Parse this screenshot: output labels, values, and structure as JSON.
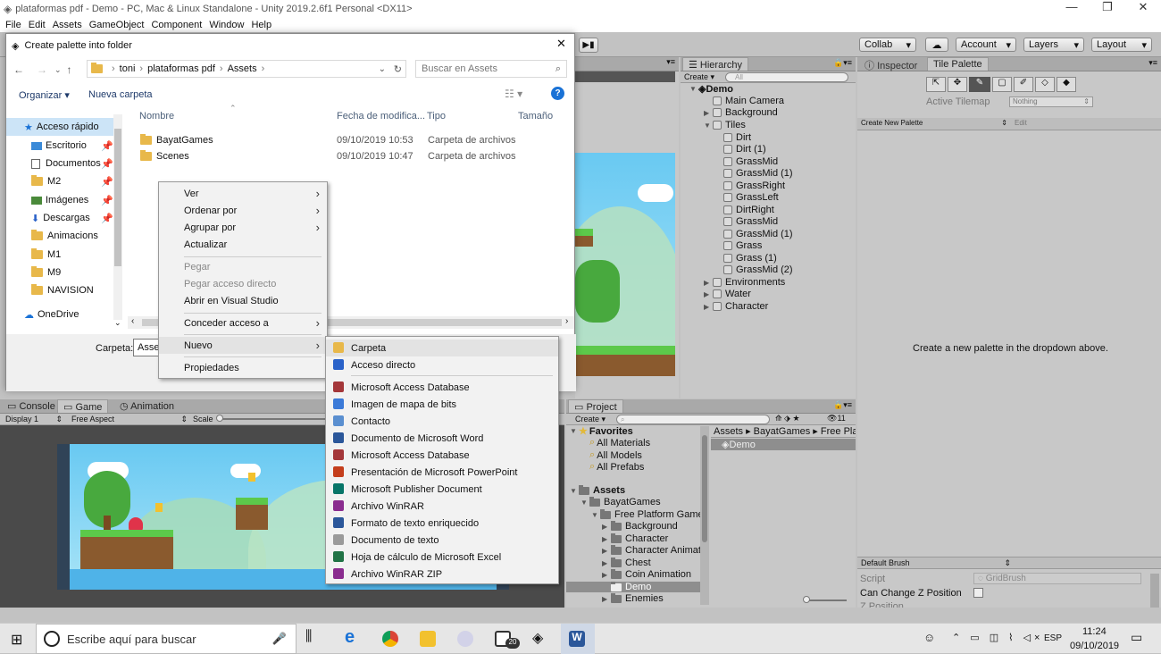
{
  "unity": {
    "window_title": "plataformas pdf - Demo - PC, Mac & Linux Standalone - Unity 2019.2.6f1 Personal <DX11>",
    "menu": [
      "File",
      "Edit",
      "Assets",
      "GameObject",
      "Component",
      "Window",
      "Help"
    ],
    "toolbar": {
      "collab": "Collab",
      "account": "Account",
      "layers": "Layers",
      "layout": "Layout"
    },
    "hierarchy": {
      "tab": "Hierarchy",
      "create": "Create",
      "search_placeholder": "All",
      "scene": "Demo",
      "items": [
        "Main Camera",
        "Background",
        "Tiles",
        "Dirt",
        "Dirt (1)",
        "GrassMid",
        "GrassMid (1)",
        "GrassRight",
        "GrassLeft",
        "DirtRight",
        "GrassMid",
        "GrassMid (1)",
        "Grass",
        "Grass (1)",
        "GrassMid (2)",
        "Environments",
        "Water",
        "Character"
      ]
    },
    "inspector": {
      "tab": "Inspector"
    },
    "tile_palette": {
      "tab": "Tile Palette",
      "active_tilemap_label": "Active Tilemap",
      "active_tilemap_value": "Nothing",
      "palette_dropdown": "Create New Palette",
      "edit": "Edit",
      "empty_message": "Create a new palette in the dropdown above.",
      "default_brush": "Default Brush",
      "script_label": "Script",
      "script_value": "GridBrush",
      "can_change_z": "Can Change Z Position",
      "z_position": "Z Position"
    },
    "bottom_tabs": {
      "console": "Console",
      "game": "Game",
      "animation": "Animation",
      "display": "Display 1",
      "aspect": "Free Aspect",
      "scale": "Scale"
    },
    "project": {
      "tab": "Project",
      "create": "Create",
      "count": "11",
      "favorites_label": "Favorites",
      "favorites": [
        "All Materials",
        "All Models",
        "All Prefabs"
      ],
      "assets_label": "Assets",
      "tree": [
        "BayatGames",
        "Free Platform Game",
        "Background",
        "Character",
        "Character Animat",
        "Chest",
        "Coin Animation",
        "Demo",
        "Enemies"
      ],
      "breadcrumb": [
        "Assets",
        "BayatGames",
        "Free Pla"
      ],
      "selected_asset": "Demo"
    }
  },
  "dialog": {
    "title": "Create palette into folder",
    "path": [
      "toni",
      "plataformas pdf",
      "Assets"
    ],
    "search_placeholder": "Buscar en Assets",
    "organize": "Organizar",
    "new_folder": "Nueva carpeta",
    "nav": [
      "Acceso rápido",
      "Escritorio",
      "Documentos",
      "M2",
      "Imágenes",
      "Descargas",
      "Animacions",
      "M1",
      "M9",
      "NAVISION",
      "OneDrive"
    ],
    "columns": [
      "Nombre",
      "Fecha de modifica...",
      "Tipo",
      "Tamaño"
    ],
    "files": [
      {
        "name": "BayatGames",
        "date": "09/10/2019 10:53",
        "type": "Carpeta de archivos"
      },
      {
        "name": "Scenes",
        "date": "09/10/2019 10:47",
        "type": "Carpeta de archivos"
      }
    ],
    "folder_label": "Carpeta:",
    "folder_value": "Asset"
  },
  "context_menu": {
    "items": [
      {
        "label": "Ver",
        "sub": true,
        "disabled": false
      },
      {
        "label": "Ordenar por",
        "sub": true,
        "disabled": false
      },
      {
        "label": "Agrupar por",
        "sub": true,
        "disabled": false
      },
      {
        "label": "Actualizar",
        "sub": false,
        "disabled": false
      },
      {
        "label": "Pegar",
        "sub": false,
        "disabled": true
      },
      {
        "label": "Pegar acceso directo",
        "sub": false,
        "disabled": true
      },
      {
        "label": "Abrir en Visual Studio",
        "sub": false,
        "disabled": false
      },
      {
        "label": "Conceder acceso a",
        "sub": true,
        "disabled": false
      },
      {
        "label": "Nuevo",
        "sub": true,
        "disabled": false
      },
      {
        "label": "Propiedades",
        "sub": false,
        "disabled": false
      }
    ]
  },
  "new_submenu": {
    "items": [
      {
        "label": "Carpeta",
        "icon": "folder-icon",
        "color": "#e8b84a"
      },
      {
        "label": "Acceso directo",
        "icon": "shortcut-icon",
        "color": "#2a62c9"
      },
      {
        "label": "Microsoft Access Database",
        "icon": "access-icon",
        "color": "#a4373a"
      },
      {
        "label": "Imagen de mapa de bits",
        "icon": "bitmap-icon",
        "color": "#3b7ad8"
      },
      {
        "label": "Contacto",
        "icon": "contact-icon",
        "color": "#5a8fd0"
      },
      {
        "label": "Documento de Microsoft Word",
        "icon": "word-icon",
        "color": "#2b579a"
      },
      {
        "label": "Microsoft Access Database",
        "icon": "access-icon",
        "color": "#a4373a"
      },
      {
        "label": "Presentación de Microsoft PowerPoint",
        "icon": "powerpoint-icon",
        "color": "#c43e1c"
      },
      {
        "label": "Microsoft Publisher Document",
        "icon": "publisher-icon",
        "color": "#077568"
      },
      {
        "label": "Archivo WinRAR",
        "icon": "winrar-icon",
        "color": "#8a2c8f"
      },
      {
        "label": "Formato de texto enriquecido",
        "icon": "rtf-icon",
        "color": "#2b579a"
      },
      {
        "label": "Documento de texto",
        "icon": "text-file-icon",
        "color": "#9a9a9a"
      },
      {
        "label": "Hoja de cálculo de Microsoft Excel",
        "icon": "excel-icon",
        "color": "#217346"
      },
      {
        "label": "Archivo WinRAR ZIP",
        "icon": "winrar-zip-icon",
        "color": "#8a2c8f"
      }
    ]
  },
  "taskbar": {
    "search_placeholder": "Escribe aquí para buscar",
    "mail_badge": "20",
    "language": "ESP",
    "time": "11:24",
    "date": "09/10/2019"
  }
}
